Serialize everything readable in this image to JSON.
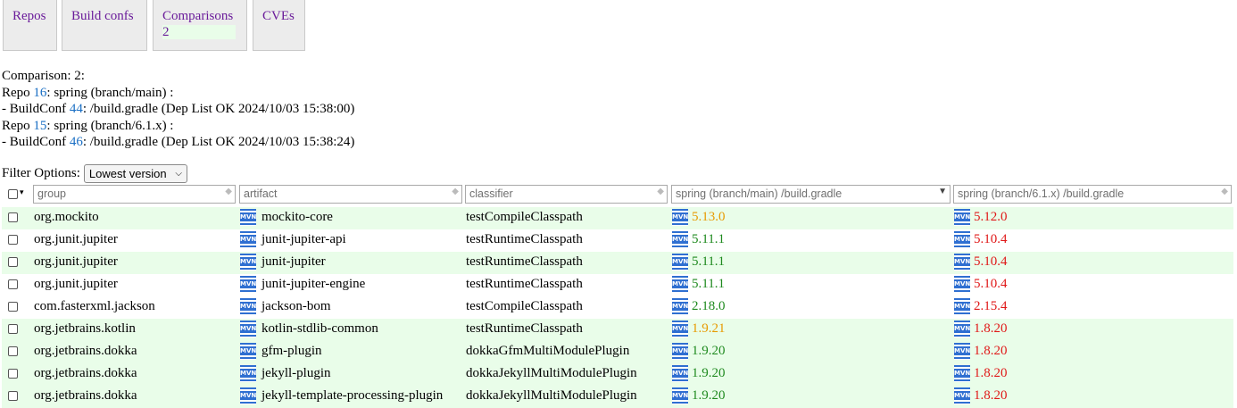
{
  "tabs": [
    {
      "label": "Repos"
    },
    {
      "label": "Build confs"
    },
    {
      "label": "Comparisons",
      "count": "2"
    },
    {
      "label": "CVEs"
    }
  ],
  "info": {
    "comparison": "Comparison: 2:",
    "repo_prefix": "Repo ",
    "buildconf_prefix": "- BuildConf ",
    "repos": [
      {
        "id": "16",
        "desc": ": spring (branch/main) :",
        "buildconf_id": "44",
        "buildconf_desc": ": /build.gradle (Dep List OK 2024/10/03 15:38:00)"
      },
      {
        "id": "15",
        "desc": ": spring (branch/6.1.x) :",
        "buildconf_id": "46",
        "buildconf_desc": ": /build.gradle (Dep List OK 2024/10/03 15:38:24)"
      }
    ]
  },
  "filter": {
    "label": "Filter Options:",
    "selected": "Lowest version"
  },
  "table": {
    "columns": {
      "group": "group",
      "artifact": "artifact",
      "classifier": "classifier",
      "col1": "spring (branch/main) /build.gradle",
      "col2": "spring (branch/6.1.x) /build.gradle"
    },
    "mvn_label": "MVN",
    "rows": [
      {
        "group": "org.mockito",
        "artifact": "mockito-core",
        "classifier": "testCompileClasspath",
        "v1": "5.13.0",
        "v2": "5.12.0"
      },
      {
        "group": "org.junit.jupiter",
        "artifact": "junit-jupiter-api",
        "classifier": "testRuntimeClasspath",
        "v1": "5.11.1",
        "v2": "5.10.4"
      },
      {
        "group": "org.junit.jupiter",
        "artifact": "junit-jupiter",
        "classifier": "testRuntimeClasspath",
        "v1": "5.11.1",
        "v2": "5.10.4"
      },
      {
        "group": "org.junit.jupiter",
        "artifact": "junit-jupiter-engine",
        "classifier": "testRuntimeClasspath",
        "v1": "5.11.1",
        "v2": "5.10.4"
      },
      {
        "group": "com.fasterxml.jackson",
        "artifact": "jackson-bom",
        "classifier": "testCompileClasspath",
        "v1": "2.18.0",
        "v2": "2.15.4"
      },
      {
        "group": "org.jetbrains.kotlin",
        "artifact": "kotlin-stdlib-common",
        "classifier": "testRuntimeClasspath",
        "v1": "1.9.21",
        "v2": "1.8.20"
      },
      {
        "group": "org.jetbrains.dokka",
        "artifact": "gfm-plugin",
        "classifier": "dokkaGfmMultiModulePlugin",
        "v1": "1.9.20",
        "v2": "1.8.20"
      },
      {
        "group": "org.jetbrains.dokka",
        "artifact": "jekyll-plugin",
        "classifier": "dokkaJekyllMultiModulePlugin",
        "v1": "1.9.20",
        "v2": "1.8.20"
      },
      {
        "group": "org.jetbrains.dokka",
        "artifact": "jekyll-template-processing-plugin",
        "classifier": "dokkaJekyllMultiModulePlugin",
        "v1": "1.9.20",
        "v2": "1.8.20"
      }
    ],
    "row_colors": [
      "green",
      "white",
      "green",
      "white",
      "white",
      "green",
      "green",
      "green",
      "green"
    ],
    "v1_colors": [
      "orange",
      "green",
      "green",
      "green",
      "green",
      "orange",
      "green",
      "green",
      "green"
    ],
    "v2_colors": [
      "red",
      "red",
      "red",
      "red",
      "red",
      "red",
      "red",
      "red",
      "red"
    ]
  }
}
